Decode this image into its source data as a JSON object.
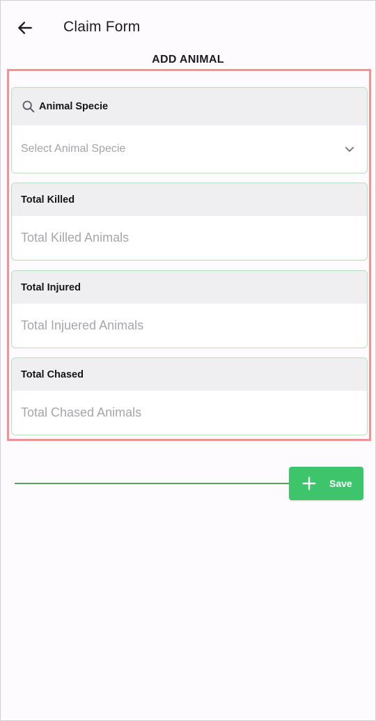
{
  "header": {
    "title": "Claim Form",
    "back_icon": "arrow-left-icon"
  },
  "section": {
    "title": "ADD ANIMAL"
  },
  "form": {
    "species": {
      "label": "Animal Specie",
      "placeholder": "Select Animal Specie",
      "icon": "search-icon",
      "dropdown_icon": "chevron-down-icon"
    },
    "killed": {
      "label": "Total Killed",
      "placeholder": "Total Killed Animals"
    },
    "injured": {
      "label": "Total Injured",
      "placeholder": "Total Injuered Animals"
    },
    "chased": {
      "label": "Total Chased",
      "placeholder": "Total Chased Animals"
    }
  },
  "actions": {
    "save_label": "Save",
    "save_icon": "plus-icon"
  },
  "colors": {
    "accent": "#3ec56b",
    "highlight_border": "#f29292",
    "field_border": "#b9deba",
    "header_bg": "#efeef0"
  }
}
